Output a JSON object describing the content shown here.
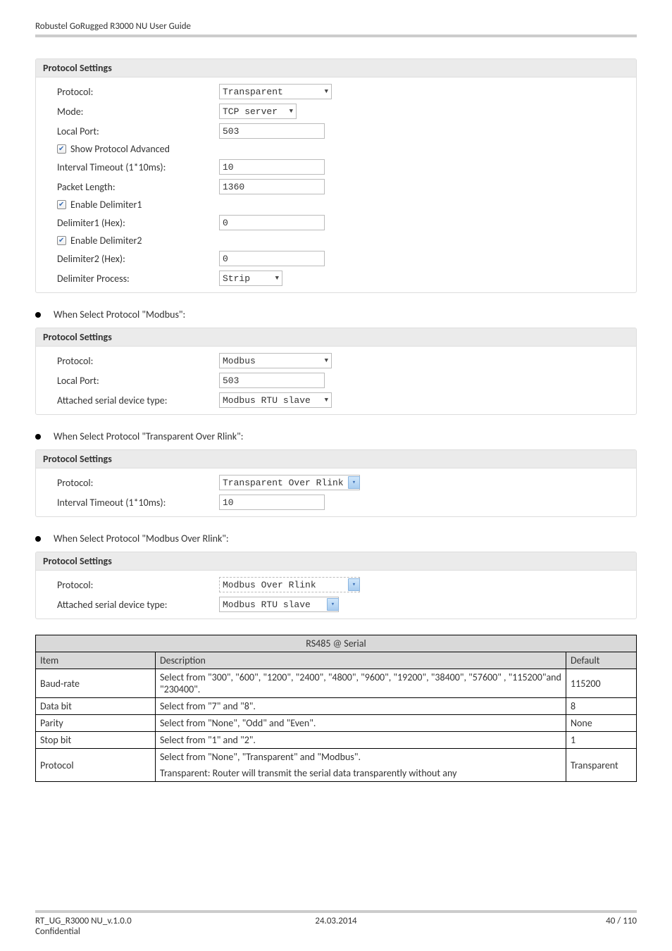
{
  "header": "Robustel GoRugged R3000 NU User Guide",
  "panel1": {
    "title": "Protocol Settings",
    "protocol_label": "Protocol:",
    "protocol_value": "Transparent",
    "mode_label": "Mode:",
    "mode_value": "TCP server",
    "localport_label": "Local Port:",
    "localport_value": "503",
    "show_adv_label": "Show Protocol Advanced",
    "interval_label": "Interval Timeout (1*10ms):",
    "interval_value": "10",
    "packet_label": "Packet Length:",
    "packet_value": "1360",
    "delim1_label": "Enable Delimiter1",
    "delim1hex_label": "Delimiter1 (Hex):",
    "delim1hex_value": "0",
    "delim2_label": "Enable Delimiter2",
    "delim2hex_label": "Delimiter2 (Hex):",
    "delim2hex_value": "0",
    "delimproc_label": "Delimiter Process:",
    "delimproc_value": "Strip"
  },
  "bullet_modbus": "When Select Protocol \"Modbus\":",
  "panel2": {
    "title": "Protocol Settings",
    "protocol_label": "Protocol:",
    "protocol_value": "Modbus",
    "localport_label": "Local Port:",
    "localport_value": "503",
    "attached_label": "Attached serial device type:",
    "attached_value": "Modbus RTU slave"
  },
  "bullet_rlink": "When Select Protocol \"Transparent Over Rlink\":",
  "panel3": {
    "title": "Protocol Settings",
    "protocol_label": "Protocol:",
    "protocol_value": "Transparent Over Rlink",
    "interval_label": "Interval Timeout (1*10ms):",
    "interval_value": "10"
  },
  "bullet_modbus_rlink": "When Select Protocol \"Modbus Over Rlink\":",
  "panel4": {
    "title": "Protocol Settings",
    "protocol_label": "Protocol:",
    "protocol_value": "Modbus Over Rlink",
    "attached_label": "Attached serial device type:",
    "attached_value": "Modbus RTU slave"
  },
  "table": {
    "title": "RS485 @ Serial",
    "col_item": "Item",
    "col_desc": "Description",
    "col_default": "Default",
    "rows": [
      {
        "item": "Baud-rate",
        "desc": "Select from \"300\", \"600\", \"1200\", \"2400\", \"4800\", \"9600\", \"19200\", \"38400\", \"57600\" , \"115200\"and \"230400\".",
        "def": "115200"
      },
      {
        "item": "Data bit",
        "desc": "Select from \"7\" and \"8\".",
        "def": "8"
      },
      {
        "item": "Parity",
        "desc": "Select from \"None\", \"Odd\" and \"Even\".",
        "def": "None"
      },
      {
        "item": "Stop bit",
        "desc": "Select from \"1\" and \"2\".",
        "def": "1"
      },
      {
        "item": "Protocol",
        "desc1": "Select from \"None\", \"Transparent\" and \"Modbus\".",
        "desc2": "Transparent: Router will transmit the serial data transparently without any",
        "def": "Transparent"
      }
    ]
  },
  "footer": {
    "left1": "RT_UG_R3000 NU_v.1.0.0",
    "left2": "Confidential",
    "center": "24.03.2014",
    "right": "40 / 110"
  }
}
